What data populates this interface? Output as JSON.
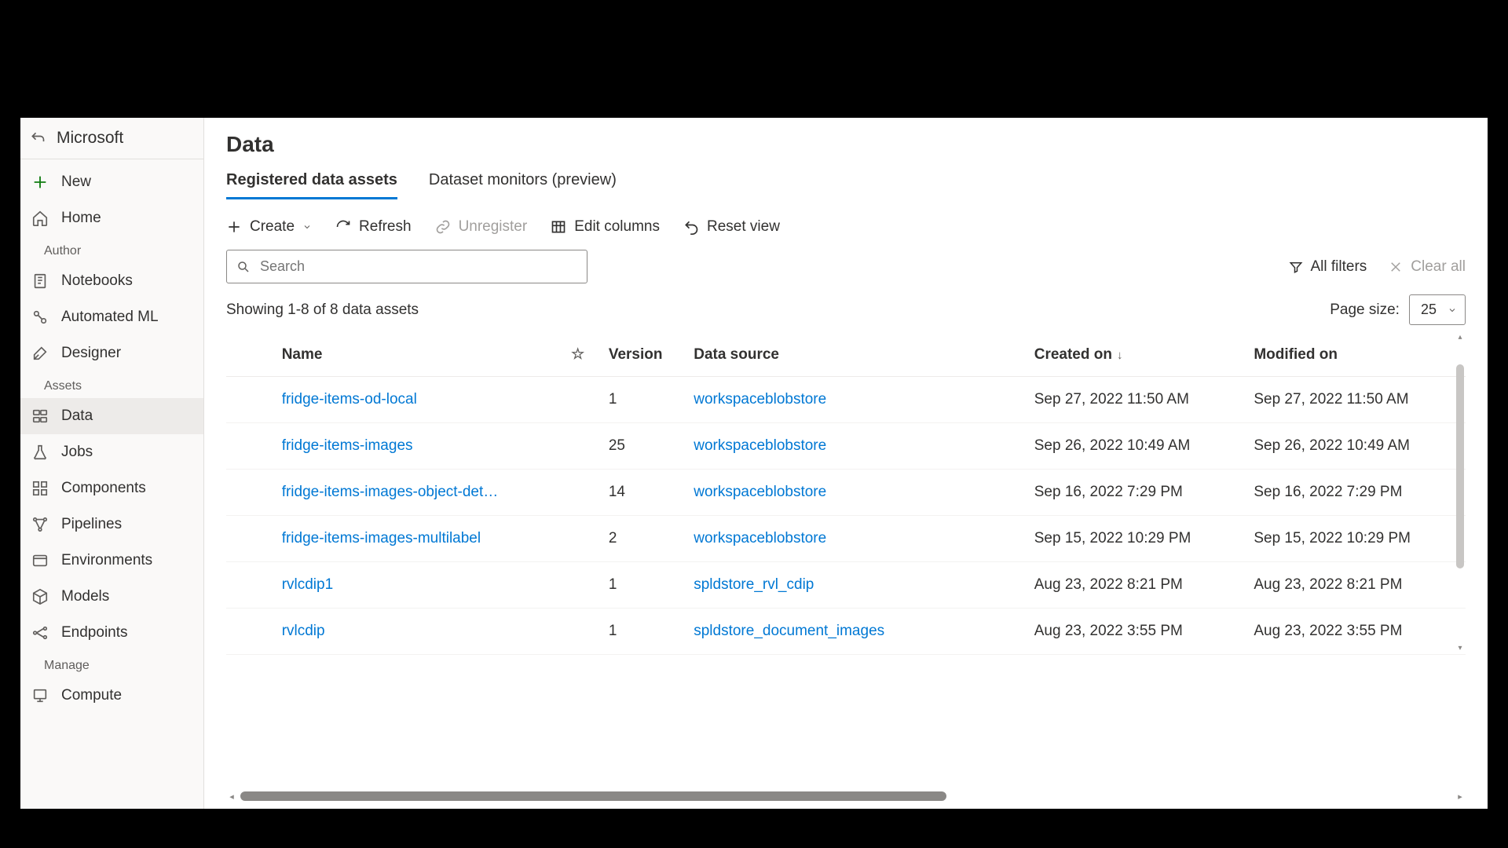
{
  "brand": "Microsoft",
  "sidebar": {
    "new_label": "New",
    "home_label": "Home",
    "group_author": "Author",
    "notebooks_label": "Notebooks",
    "automl_label": "Automated ML",
    "designer_label": "Designer",
    "group_assets": "Assets",
    "data_label": "Data",
    "jobs_label": "Jobs",
    "components_label": "Components",
    "pipelines_label": "Pipelines",
    "environments_label": "Environments",
    "models_label": "Models",
    "endpoints_label": "Endpoints",
    "group_manage": "Manage",
    "compute_label": "Compute"
  },
  "page": {
    "title": "Data"
  },
  "tabs": {
    "assets": "Registered data assets",
    "monitors": "Dataset monitors (preview)"
  },
  "toolbar": {
    "create": "Create",
    "refresh": "Refresh",
    "unregister": "Unregister",
    "edit_columns": "Edit columns",
    "reset_view": "Reset view"
  },
  "search": {
    "placeholder": "Search"
  },
  "filters": {
    "all": "All filters",
    "clear": "Clear all"
  },
  "list_meta": {
    "showing": "Showing 1-8 of 8 data assets",
    "page_size_label": "Page size:",
    "page_size_value": "25"
  },
  "columns": {
    "name": "Name",
    "version": "Version",
    "data_source": "Data source",
    "created_on": "Created on",
    "modified_on": "Modified on"
  },
  "rows": [
    {
      "name": "fridge-items-od-local",
      "version": "1",
      "source": "workspaceblobstore",
      "created": "Sep 27, 2022 11:50 AM",
      "modified": "Sep 27, 2022 11:50 AM"
    },
    {
      "name": "fridge-items-images",
      "version": "25",
      "source": "workspaceblobstore",
      "created": "Sep 26, 2022 10:49 AM",
      "modified": "Sep 26, 2022 10:49 AM"
    },
    {
      "name": "fridge-items-images-object-det…",
      "version": "14",
      "source": "workspaceblobstore",
      "created": "Sep 16, 2022 7:29 PM",
      "modified": "Sep 16, 2022 7:29 PM"
    },
    {
      "name": "fridge-items-images-multilabel",
      "version": "2",
      "source": "workspaceblobstore",
      "created": "Sep 15, 2022 10:29 PM",
      "modified": "Sep 15, 2022 10:29 PM"
    },
    {
      "name": "rvlcdip1",
      "version": "1",
      "source": "spldstore_rvl_cdip",
      "created": "Aug 23, 2022 8:21 PM",
      "modified": "Aug 23, 2022 8:21 PM"
    },
    {
      "name": "rvlcdip",
      "version": "1",
      "source": "spldstore_document_images",
      "created": "Aug 23, 2022 3:55 PM",
      "modified": "Aug 23, 2022 3:55 PM"
    }
  ]
}
